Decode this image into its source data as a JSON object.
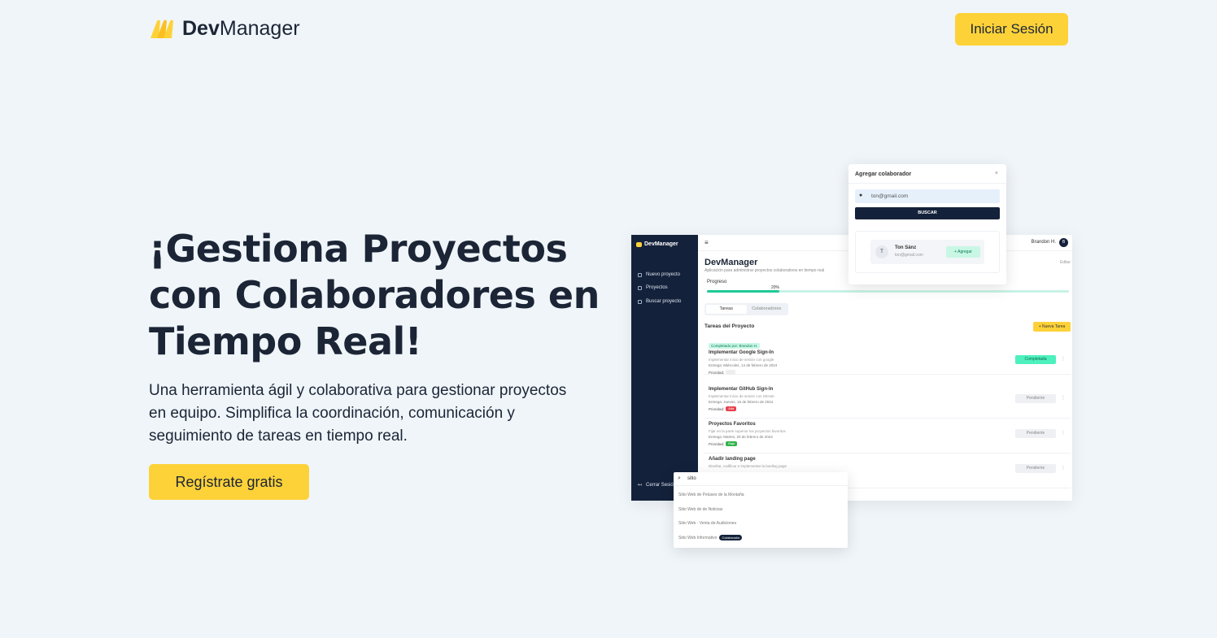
{
  "header": {
    "brand_bold": "Dev",
    "brand_light": "Manager",
    "login_label": "Iniciar Sesión"
  },
  "hero": {
    "title": "¡Gestiona Proyectos con Colaboradores en Tiempo Real!",
    "subtitle": "Una herramienta ágil y colaborativa para gestionar proyectos en equipo. Simplifica la coordinación, comunicación y seguimiento de tareas en tiempo real.",
    "cta_label": "Regístrate gratis"
  },
  "colors": {
    "background": "#f0f5f9",
    "accent": "#fdd239",
    "text": "#1b2536",
    "sidebar": "#14213a"
  },
  "mockup": {
    "sidebar": {
      "brand": "DevManager",
      "items": [
        "Nuevo proyecto",
        "Proyectos",
        "Buscar proyecto"
      ],
      "logout": "Cerrar Sesión"
    },
    "topbar": {
      "menu_icon": "≡",
      "user": "Brandon H.",
      "avatar": "B"
    },
    "project_title": "DevManager",
    "project_desc": "Aplicación para administrar proyectos colaborativos en tiempo real",
    "edit_label": "Editar",
    "progress_label": "Progreso",
    "progress_value": 0.2,
    "progress_pct": "20%",
    "tabs": [
      "Tareas",
      "Colaboradores"
    ],
    "tasks_heading": "Tareas del Proyecto",
    "new_task_label": "+ Nueva Tarea",
    "tasks": [
      {
        "badge": "Completado por: Brandon H.",
        "name": "Implementar Google Sign-In",
        "desc": "Implementar inicio de sesión con google",
        "date": "Entrega: Miércoles, 14 de febrero de 2024",
        "priority": "",
        "status": "Completada"
      },
      {
        "badge": "",
        "name": "Implementar GitHub Sign-In",
        "desc": "Implementar inicio de sesión con GitHub",
        "date": "Entrega: Jueves, 15 de febrero de 2024",
        "priority": "Alta",
        "status": "Pendiente"
      },
      {
        "badge": "",
        "name": "Proyectos Favoritos",
        "desc": "Fijar en la parte superior los proyectos favoritos",
        "date": "Entrega: Martes, 20 de febrero de 2024",
        "priority": "Baja",
        "status": "Pendiente"
      },
      {
        "badge": "",
        "name": "Añadir landing page",
        "desc": "Diseñar, codificar e implementar la landing page",
        "date": "",
        "priority": "",
        "status": "Pendiente"
      }
    ],
    "priority_label": "Prioridad:"
  },
  "collab_popup": {
    "title": "Agregar colaborador",
    "close": "×",
    "email_value": "ton@gmail.com",
    "search_label": "BUSCAR",
    "result_initial": "T",
    "result_name": "Ton Sánz",
    "result_email": "ton@gmail.com",
    "add_label": "+ Agregar"
  },
  "search_popup": {
    "query": "sitio",
    "results": [
      {
        "label": "Sitio Web de Peluses de la Montaña",
        "tag": ""
      },
      {
        "label": "Sitio Web de de Noticias",
        "tag": ""
      },
      {
        "label": "Sitio Web - Venta de Audiciones",
        "tag": ""
      },
      {
        "label": "Sitio Web Informativo",
        "tag": "Colaborador"
      }
    ]
  }
}
